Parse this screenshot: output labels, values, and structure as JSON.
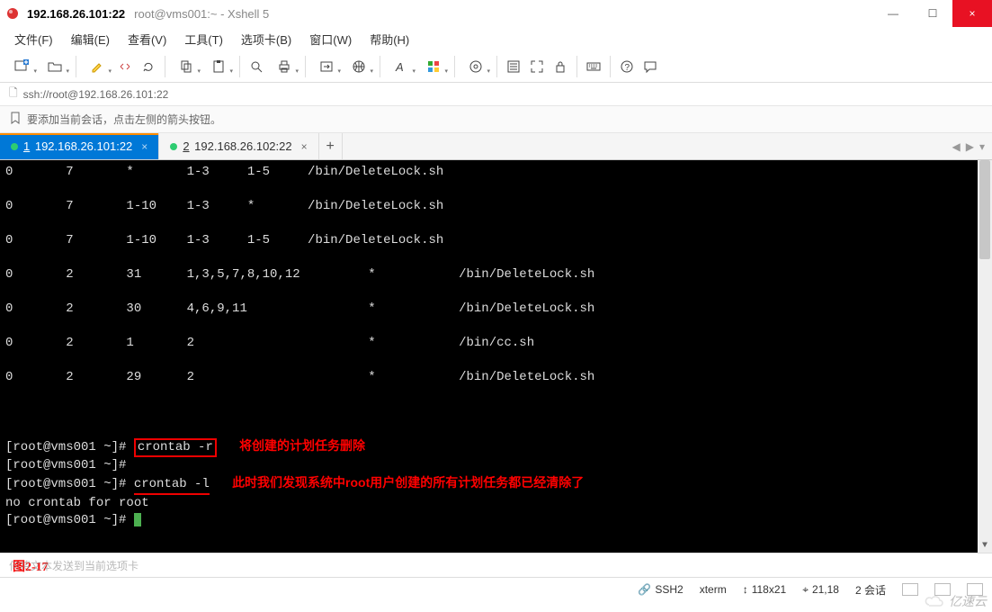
{
  "title": {
    "host": "192.168.26.101:22",
    "sub": "root@vms001:~ - Xshell 5"
  },
  "menu": {
    "file": "文件(F)",
    "edit": "编辑(E)",
    "view": "查看(V)",
    "tools": "工具(T)",
    "tabs": "选项卡(B)",
    "window": "窗口(W)",
    "help": "帮助(H)"
  },
  "address": {
    "url": "ssh://root@192.168.26.101:22"
  },
  "hint": {
    "text": "要添加当前会话，点击左侧的箭头按钮。"
  },
  "tabs": {
    "items": [
      {
        "num": "1",
        "label": " 192.168.26.101:22",
        "active": true
      },
      {
        "num": "2",
        "label": " 192.168.26.102:22",
        "active": false
      }
    ]
  },
  "terminal": {
    "cron_rows": [
      {
        "c0": "0",
        "c1": "7",
        "c2": "*",
        "c3": "1-3",
        "c4": "1-5",
        "c5": "/bin/DeleteLock.sh"
      },
      {
        "c0": "0",
        "c1": "7",
        "c2": "1-10",
        "c3": "1-3",
        "c4": "*",
        "c5": "/bin/DeleteLock.sh"
      },
      {
        "c0": "0",
        "c1": "7",
        "c2": "1-10",
        "c3": "1-3",
        "c4": "1-5",
        "c5": "/bin/DeleteLock.sh"
      },
      {
        "c0": "0",
        "c1": "2",
        "c2": "31",
        "c3": "1,3,5,7,8,10,12",
        "c4": "*",
        "c5": "/bin/DeleteLock.sh"
      },
      {
        "c0": "0",
        "c1": "2",
        "c2": "30",
        "c3": "4,6,9,11",
        "c4": "*",
        "c5": "/bin/DeleteLock.sh"
      },
      {
        "c0": "0",
        "c1": "2",
        "c2": "1",
        "c3": "2",
        "c4": "*",
        "c5": "/bin/cc.sh"
      },
      {
        "c0": "0",
        "c1": "2",
        "c2": "29",
        "c3": "2",
        "c4": "*",
        "c5": "/bin/DeleteLock.sh"
      }
    ],
    "prompt": "[root@vms001 ~]# ",
    "cmd1": "crontab -r",
    "ann1": "将创建的计划任务删除",
    "cmd2": "crontab -l",
    "ann2": "此时我们发现系统中root用户创建的所有计划任务都已经清除了",
    "msg": "no crontab for root"
  },
  "inputbar": {
    "placeholder": "何将文本发送到当前选项卡"
  },
  "figure": {
    "label": "图2-17"
  },
  "status": {
    "proto": "SSH2",
    "term": "xterm",
    "size": "118x21",
    "pos": "21,18",
    "sessions": "2 会话"
  },
  "watermark": {
    "text": "亿速云"
  },
  "icons": {
    "plus": "+",
    "close": "×",
    "min": "—",
    "max": "☐",
    "left": "◀",
    "right": "▶",
    "drop": "▾",
    "lock": "🔒",
    "flag": "⚐",
    "up": "▲",
    "dn": "▼",
    "sizesep": "↕"
  }
}
